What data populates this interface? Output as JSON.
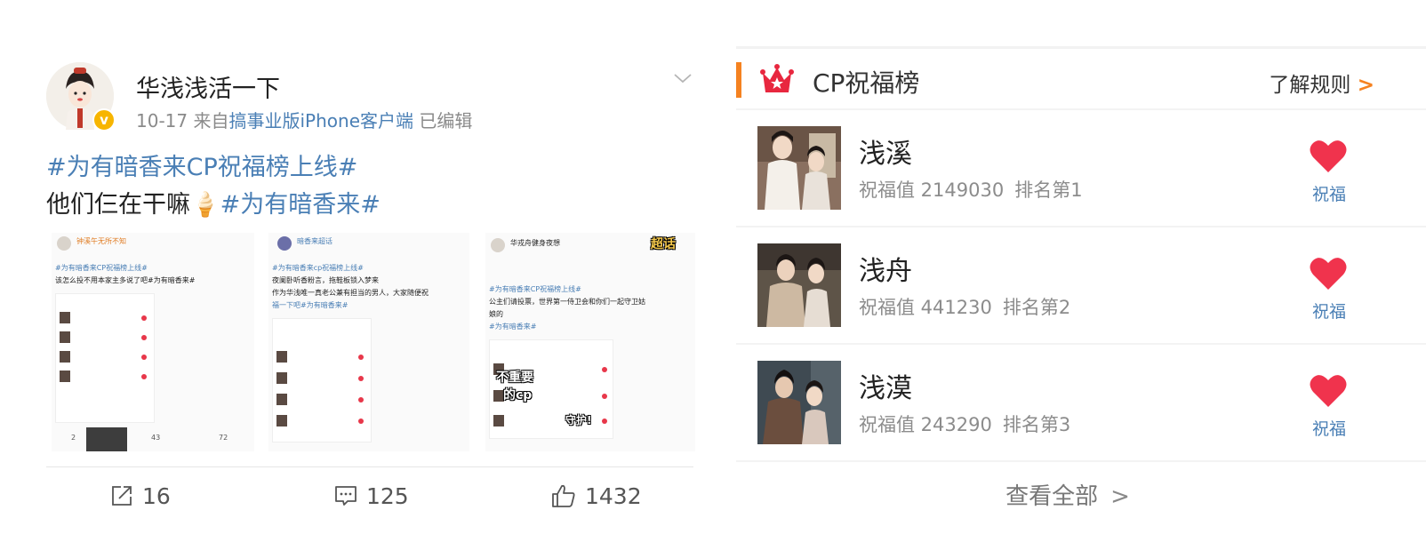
{
  "post": {
    "username": "华浅浅活一下",
    "meta_prefix": "10-17  来自",
    "meta_source": "搞事业版iPhone客户端",
    "meta_edited": "已编辑",
    "line1": "#为有暗香来CP祝福榜上线#",
    "line2_text": "他们仨在干嘛",
    "line2_emoji": "🍦",
    "line2_tag": "#为有暗香来#",
    "verified_badge": "v",
    "thumbs": [
      {
        "user": "钟溪午无所不知",
        "line_a": "#为有暗香来CP祝福榜上线#",
        "line_b": "该怎么投不用本家主多说了吧#为有暗香来#",
        "stat_share": "2",
        "stat_comment": "43",
        "stat_like": "72"
      },
      {
        "user": "暗香来超话",
        "line_a": "#为有暗香来cp祝福榜上线#",
        "line_b": "夜阑卧听香粉言，拖鞋板锁入梦来",
        "line_c": "作为华浅唯一真老公兼有担当的男人，大家随便祝",
        "line_d": "福一下吧#为有暗香来#"
      },
      {
        "user": "华戎舟健身夜想",
        "sticker_a": "超话",
        "line_a": "#为有暗香来CP祝福榜上线#",
        "line_b": "公主们请投票，世界第一侍卫会和你们一起守卫姑",
        "line_c": "娘的",
        "line_d": "#为有暗香来#",
        "sticker_b": "不重要",
        "sticker_c": "的cp",
        "sticker_d": "守护!"
      }
    ],
    "actions": {
      "share_count": "16",
      "comment_count": "125",
      "like_count": "1432"
    }
  },
  "board": {
    "title": "CP祝福榜",
    "rules_label": "了解规则",
    "rules_arrow": ">",
    "entries": [
      {
        "name": "浅溪",
        "value_label": "祝福值 2149030",
        "rank_label": "排名第1",
        "button": "祝福"
      },
      {
        "name": "浅舟",
        "value_label": "祝福值 441230",
        "rank_label": "排名第2",
        "button": "祝福"
      },
      {
        "name": "浅漠",
        "value_label": "祝福值 243290",
        "rank_label": "排名第3",
        "button": "祝福"
      }
    ],
    "view_all": "查看全部",
    "view_all_arrow": ">"
  },
  "colors": {
    "link_blue": "#4a7fb5",
    "accent_orange": "#f58220",
    "heart_red": "#f0334d",
    "crown_red": "#e8273f"
  },
  "icons": [
    "chevron-down-icon",
    "share-icon",
    "comment-icon",
    "like-icon",
    "crown-icon",
    "heart-icon",
    "chevron-right-icon"
  ]
}
